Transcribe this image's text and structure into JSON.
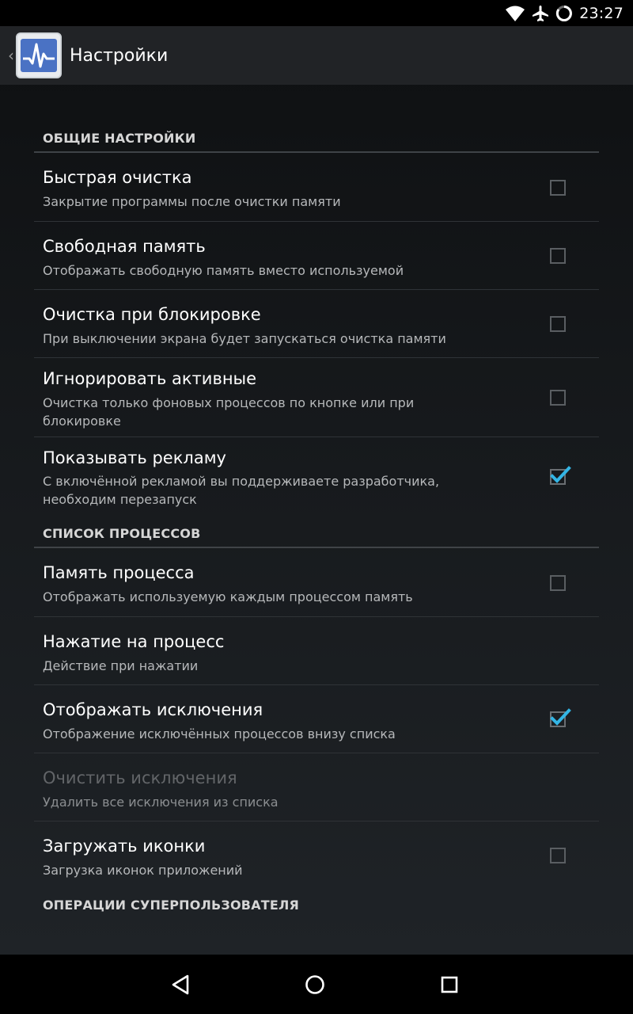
{
  "status_bar": {
    "time": "23:27",
    "icons": [
      "wifi-icon",
      "airplane-icon",
      "battery-charging-icon"
    ]
  },
  "action_bar": {
    "title": "Настройки",
    "app_icon": "activity-monitor-icon",
    "up_icon": "back-caret-icon"
  },
  "sections": [
    {
      "header": "ОБЩИЕ НАСТРОЙКИ",
      "items": [
        {
          "title": "Быстрая очистка",
          "summary": "Закрытие программы после очистки памяти",
          "checkbox": true,
          "checked": false
        },
        {
          "title": "Свободная память",
          "summary": "Отображать свободную память вместо используемой",
          "checkbox": true,
          "checked": false
        },
        {
          "title": "Очистка при блокировке",
          "summary": "При выключении экрана будет запускаться очистка памяти",
          "checkbox": true,
          "checked": false
        },
        {
          "title": "Игнорировать активные",
          "summary": "Очистка только фоновых процессов по кнопке или при блокировке",
          "checkbox": true,
          "checked": false
        },
        {
          "title": "Показывать рекламу",
          "summary": "С включённой рекламой вы поддерживаете разработчика, необходим перезапуск",
          "checkbox": true,
          "checked": true
        }
      ]
    },
    {
      "header": "СПИСОК ПРОЦЕССОВ",
      "items": [
        {
          "title": "Память процесса",
          "summary": "Отображать используемую каждым процессом память",
          "checkbox": true,
          "checked": false
        },
        {
          "title": "Нажатие на процесс",
          "summary": "Действие при нажатии",
          "checkbox": false
        },
        {
          "title": "Отображать исключения",
          "summary": "Отображение исключённых процессов внизу списка",
          "checkbox": true,
          "checked": true
        },
        {
          "title": "Очистить исключения",
          "summary": "Удалить все исключения из списка",
          "checkbox": false,
          "disabled": true
        },
        {
          "title": "Загружать иконки",
          "summary": "Загрузка иконок приложений",
          "checkbox": true,
          "checked": false
        }
      ]
    },
    {
      "header": "ОПЕРАЦИИ СУПЕРПОЛЬЗОВАТЕЛЯ",
      "items": []
    }
  ],
  "colors": {
    "accent": "#33b5e5",
    "background_top": "#0d0f11",
    "background_bottom": "#1f2327",
    "action_bar": "#212326",
    "divider": "#2f3337"
  },
  "nav_bar": {
    "buttons": [
      "back-icon",
      "home-icon",
      "recents-icon"
    ]
  }
}
